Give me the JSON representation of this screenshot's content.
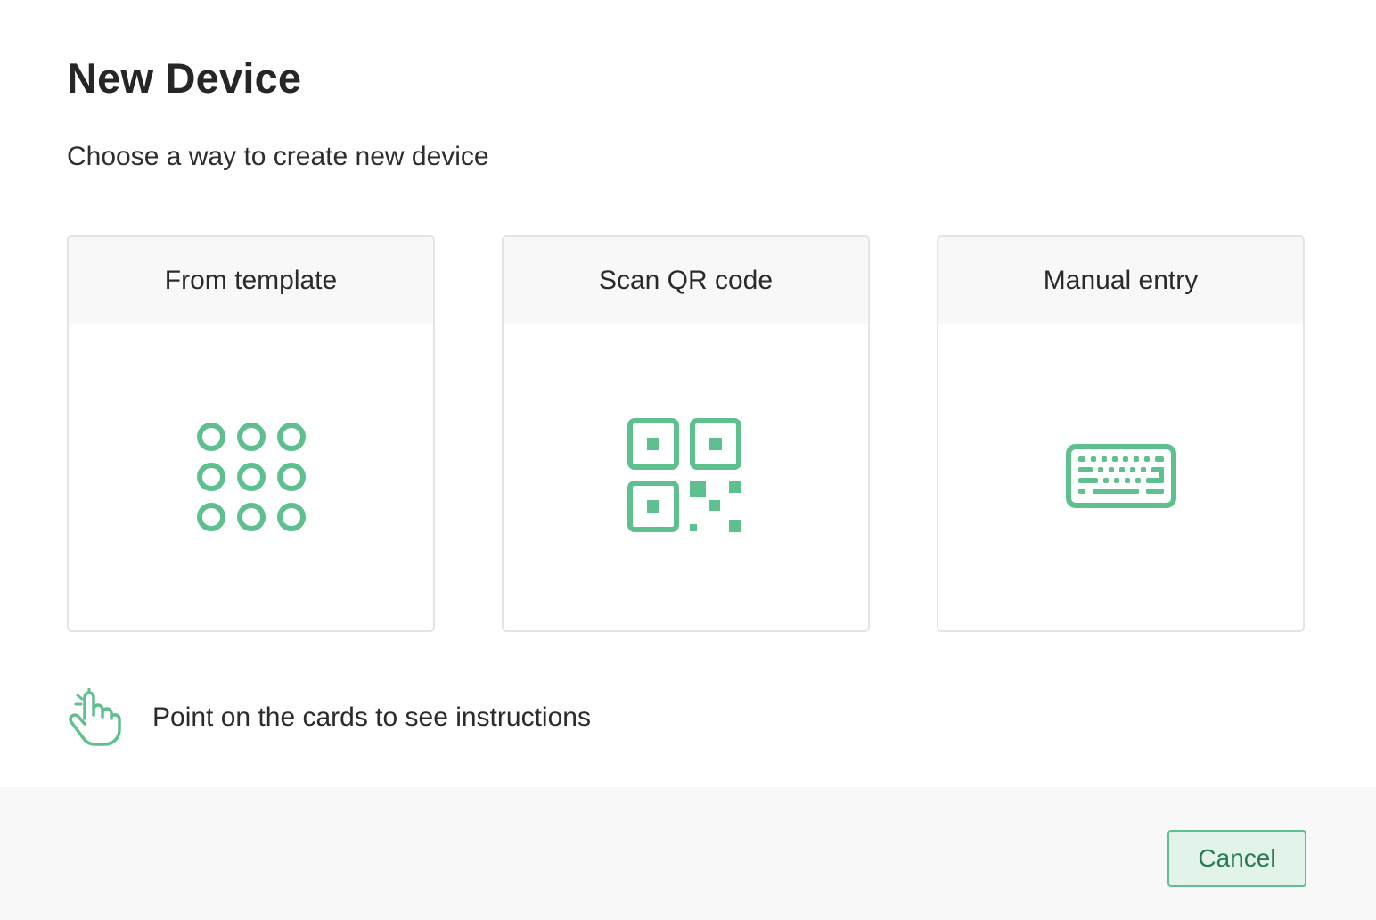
{
  "dialog": {
    "title": "New Device",
    "subtitle": "Choose a way to create new device"
  },
  "cards": [
    {
      "label": "From template",
      "icon": "grid-circles-icon"
    },
    {
      "label": "Scan QR code",
      "icon": "qr-code-icon"
    },
    {
      "label": "Manual entry",
      "icon": "keyboard-icon"
    }
  ],
  "hint": {
    "icon": "pointing-hand-icon",
    "text": "Point on the cards to see instructions"
  },
  "footer": {
    "cancel_label": "Cancel"
  },
  "colors": {
    "accent": "#5ec08e",
    "button_bg": "#e2f4ea",
    "button_text": "#2a7a52",
    "card_header_bg": "#f8f8f8",
    "footer_bg": "#f8f8f8"
  }
}
